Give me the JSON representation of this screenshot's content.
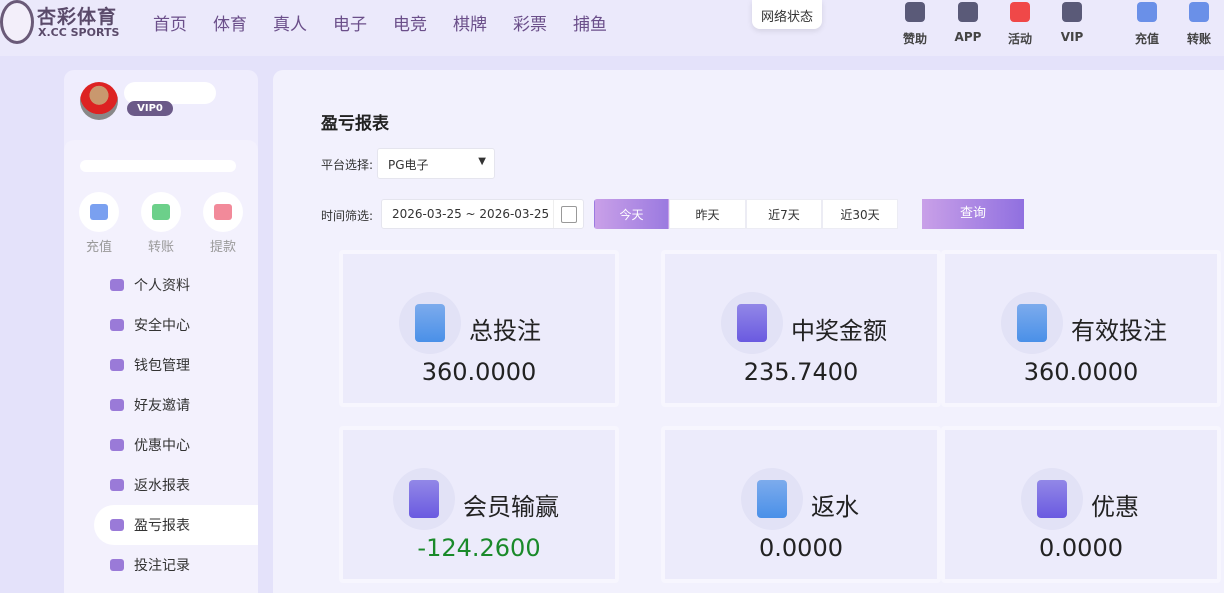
{
  "header": {
    "logo_cn": "杏彩体育",
    "logo_en": "X.CC SPORTS",
    "nav": [
      "首页",
      "体育",
      "真人",
      "电子",
      "电竞",
      "棋牌",
      "彩票",
      "捕鱼"
    ],
    "network_status": "网络状态",
    "actions": [
      {
        "label": "赞助",
        "icon": "handshake-icon",
        "color": "#5a5a78"
      },
      {
        "label": "APP",
        "icon": "phone-icon",
        "color": "#5a5a78"
      },
      {
        "label": "活动",
        "icon": "gift-icon",
        "color": "#f04848"
      },
      {
        "label": "VIP",
        "icon": "diamond-icon",
        "color": "#5a5a78"
      },
      {
        "label": "充值",
        "icon": "wallet-icon",
        "color": "#6a90e8"
      },
      {
        "label": "转账",
        "icon": "transfer-icon",
        "color": "#6a90e8"
      }
    ]
  },
  "sidebar": {
    "vip": "VIP0",
    "quick": [
      {
        "label": "充值",
        "color": "#7aa0f0"
      },
      {
        "label": "转账",
        "color": "#6cd08a"
      },
      {
        "label": "提款",
        "color": "#f28a9a"
      }
    ],
    "menu": [
      "个人资料",
      "安全中心",
      "钱包管理",
      "好友邀请",
      "优惠中心",
      "返水报表",
      "盈亏报表",
      "投注记录"
    ],
    "active": "盈亏报表"
  },
  "main": {
    "title": "盈亏报表",
    "platform_label": "平台选择:",
    "platform_value": "PG电子",
    "time_label": "时间筛选:",
    "date_range": "2026-03-25 ~ 2026-03-25",
    "ranges": [
      "今天",
      "昨天",
      "近7天",
      "近30天"
    ],
    "selected_range": "今天",
    "query": "查询",
    "cards": [
      {
        "name": "总投注",
        "value": "360.0000",
        "color": "#4a90e8"
      },
      {
        "name": "中奖金额",
        "value": "235.7400",
        "color": "#6a5ae0"
      },
      {
        "name": "有效投注",
        "value": "360.0000",
        "color": "#4a90e8"
      },
      {
        "name": "会员输赢",
        "value": "-124.2600",
        "color": "#6a5ae0",
        "value_color": "#1a8a2a"
      },
      {
        "name": "返水",
        "value": "0.0000",
        "color": "#4a90e8"
      },
      {
        "name": "优惠",
        "value": "0.0000",
        "color": "#6a5ae0"
      }
    ]
  }
}
